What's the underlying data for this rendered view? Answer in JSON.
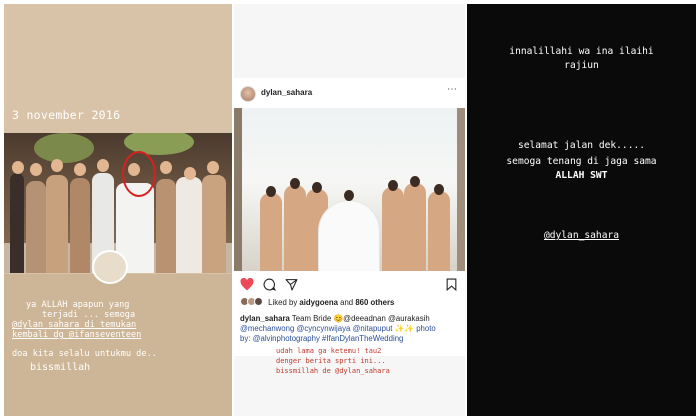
{
  "panel1": {
    "date": "3 november 2016",
    "caption_lines": [
      "ya ALLAH apapun yang",
      "terjadi ... semoga",
      "@dylan_sahara di temukan",
      "kembali dg @ifanseventeen",
      "doa kita selalu untukmu de..",
      "bissmillah"
    ]
  },
  "panel2": {
    "username": "dylan_sahara",
    "more_icon": "⋯",
    "liked_by_prefix": "Liked by",
    "liked_by_user": "aidygoena",
    "liked_by_and": "and",
    "liked_by_count": "860 others",
    "caption_user": "dylan_sahara",
    "caption_text": "Team Bride 😊@deeadnan @aurakasih",
    "caption_line2": "@mechanwong @cyncynwijaya @nitapuput ✨✨ photo",
    "caption_line3": "by: @alvinphotography #IfanDylanTheWedding",
    "red_lines": [
      "udah lama ga ketemu! tau2",
      "denger berita sprti ini...",
      "bissmillah de @dylan_sahara"
    ],
    "icons": [
      "heart-icon",
      "comment-icon",
      "send-icon",
      "bookmark-icon"
    ]
  },
  "panel3": {
    "lines": [
      "innalillahi wa ina ilaihi",
      "rajiun",
      "selamat jalan dek.....",
      "semoga tenang di jaga sama",
      "ALLAH SWT",
      "@dylan_sahara"
    ]
  }
}
